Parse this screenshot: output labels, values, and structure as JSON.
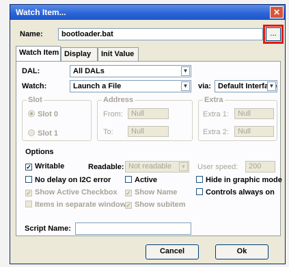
{
  "window": {
    "title": "Watch Item...",
    "close": "✕"
  },
  "name": {
    "label": "Name:",
    "value": "bootloader.bat",
    "browse": "..."
  },
  "tabs": [
    {
      "label": "Watch Item"
    },
    {
      "label": "Display"
    },
    {
      "label": "Init Value"
    }
  ],
  "dal": {
    "label": "DAL:",
    "value": "All DALs"
  },
  "watch": {
    "label": "Watch:",
    "value": "Launch a File",
    "via_label": "via:",
    "via_value": "Default Interface"
  },
  "slot": {
    "title": "Slot",
    "opt1": "Slot 0",
    "opt2": "Slot 1"
  },
  "address": {
    "title": "Address",
    "from_label": "From:",
    "from_value": "Null",
    "to_label": "To:",
    "to_value": "Null"
  },
  "extra": {
    "title": "Extra",
    "e1_label": "Extra 1:",
    "e1_value": "Null",
    "e2_label": "Extra 2:",
    "e2_value": "Null"
  },
  "options": {
    "title": "Options",
    "writable": "Writable",
    "readable_label": "Readable:",
    "readable_value": "Not readable",
    "user_speed_label": "User speed:",
    "user_speed_value": "200",
    "no_delay": "No delay on I2C error",
    "active": "Active",
    "hide_graphic": "Hide in graphic mode",
    "show_active_checkbox": "Show Active Checkbox",
    "show_name": "Show Name",
    "controls_always_on": "Controls always on",
    "items_separate": "Items in separate window",
    "show_subitem": "Show subitem"
  },
  "script": {
    "label": "Script Name:",
    "value": ""
  },
  "buttons": {
    "cancel": "Cancel",
    "ok": "Ok"
  }
}
